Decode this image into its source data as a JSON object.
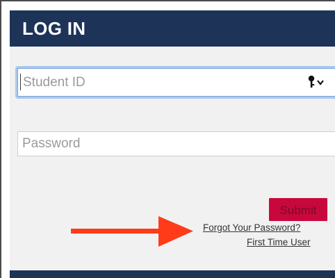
{
  "header": {
    "title": "LOG IN"
  },
  "student_id": {
    "placeholder": "Student ID",
    "icon": "key-dropdown-icon"
  },
  "password": {
    "placeholder": "Password"
  },
  "submit": {
    "label": "Submit"
  },
  "links": {
    "forgot_password": "Forgot Your Password?",
    "first_time_user": "First Time User"
  },
  "annotation": {
    "arrow": "red-arrow",
    "color": "#ff3b1a"
  },
  "colors": {
    "header": "#1d3358",
    "panel": "#f1f1f1",
    "submit": "#c8083c",
    "focus": "#a9c8ee"
  }
}
